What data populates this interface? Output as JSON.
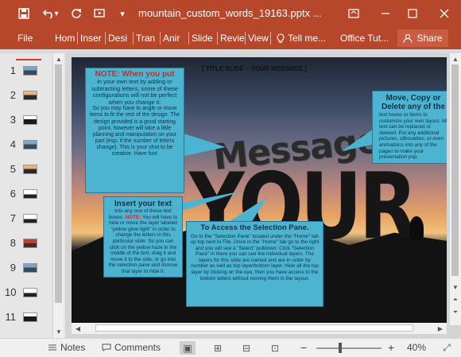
{
  "window": {
    "doc_title": "mountain_custom_words_19163.pptx ...",
    "icons": [
      "save-icon",
      "undo-icon",
      "redo-icon",
      "start-from-beginning-icon",
      "customize-icon"
    ]
  },
  "ribbon": {
    "file": "File",
    "tabs": [
      "Hom",
      "Inser",
      "Desi",
      "Tran",
      "Anir",
      "Slide",
      "Revie",
      "View"
    ],
    "tell_me": "Tell me...",
    "office_tutorials": "Office Tut...",
    "share": "Share"
  },
  "thumbnails": [
    {
      "num": "1",
      "style": "sky"
    },
    {
      "num": "2",
      "style": "sunset"
    },
    {
      "num": "3",
      "style": "dark"
    },
    {
      "num": "4",
      "style": "sky"
    },
    {
      "num": "5",
      "style": "sunset"
    },
    {
      "num": "6",
      "style": "white"
    },
    {
      "num": "7",
      "style": "white"
    },
    {
      "num": "8",
      "style": "red"
    },
    {
      "num": "9",
      "style": "sky"
    },
    {
      "num": "10",
      "style": "white"
    },
    {
      "num": "11",
      "style": "dark"
    }
  ],
  "slide": {
    "title": "[ TITLE SLIDE – YOUR MESSAGE ]",
    "art_word_top": "Message",
    "art_word_bottom": "YOUR",
    "callout_1": {
      "heading": "NOTE: When you put",
      "body_big": "in your own text by adding or subtracting letters, some of these configurations will not be perfect when you change it.",
      "body": "So you may have to angle or move items to fit the rest of the design. The design provided is a good starting point, however will take a little planning and manipulation on your part (esp. if the number of letters change). This is your shot to be creative. Have fun!"
    },
    "callout_2": {
      "heading": "Move, Copy or Delete any of the",
      "body": "text boxes or items to customize your own layout. All text can be replaced or deleted. Put any additional pictures, silhouettes, or even animations into any of the pages to make your presentation pop."
    },
    "callout_3": {
      "heading": "Insert your text",
      "body_pre": "Into any one of these text boxes.",
      "note": "NOTE:",
      "body_post": "You will have to hide or move the layer labeled \"yellow glow light\" in order to change the letters in this particular slide. So you can click on the yellow haze in the middle of the text, drag it and move it to the side, or go into the selection pane and choose that layer to hide it."
    },
    "callout_4": {
      "heading": "To Access the Selection Pane.",
      "body": "Go to the \"Selection Pane\" located under the \"Home\" tab up top next to File. Once in the \"Home\" tab go to the right and you will see a \"Select\" pulldown. Click \"Selection Pane\" in there you can see the individual layers. The layers for this slide are named and are in order by number as well as top layer/bottom layer. Hide all the top layer by clicking on the eye, then you have access to the bottom letters without moving them in the layout."
    }
  },
  "statusbar": {
    "notes": "Notes",
    "comments": "Comments",
    "zoom_minus": "−",
    "zoom_plus": "+",
    "zoom_level": "40%"
  }
}
